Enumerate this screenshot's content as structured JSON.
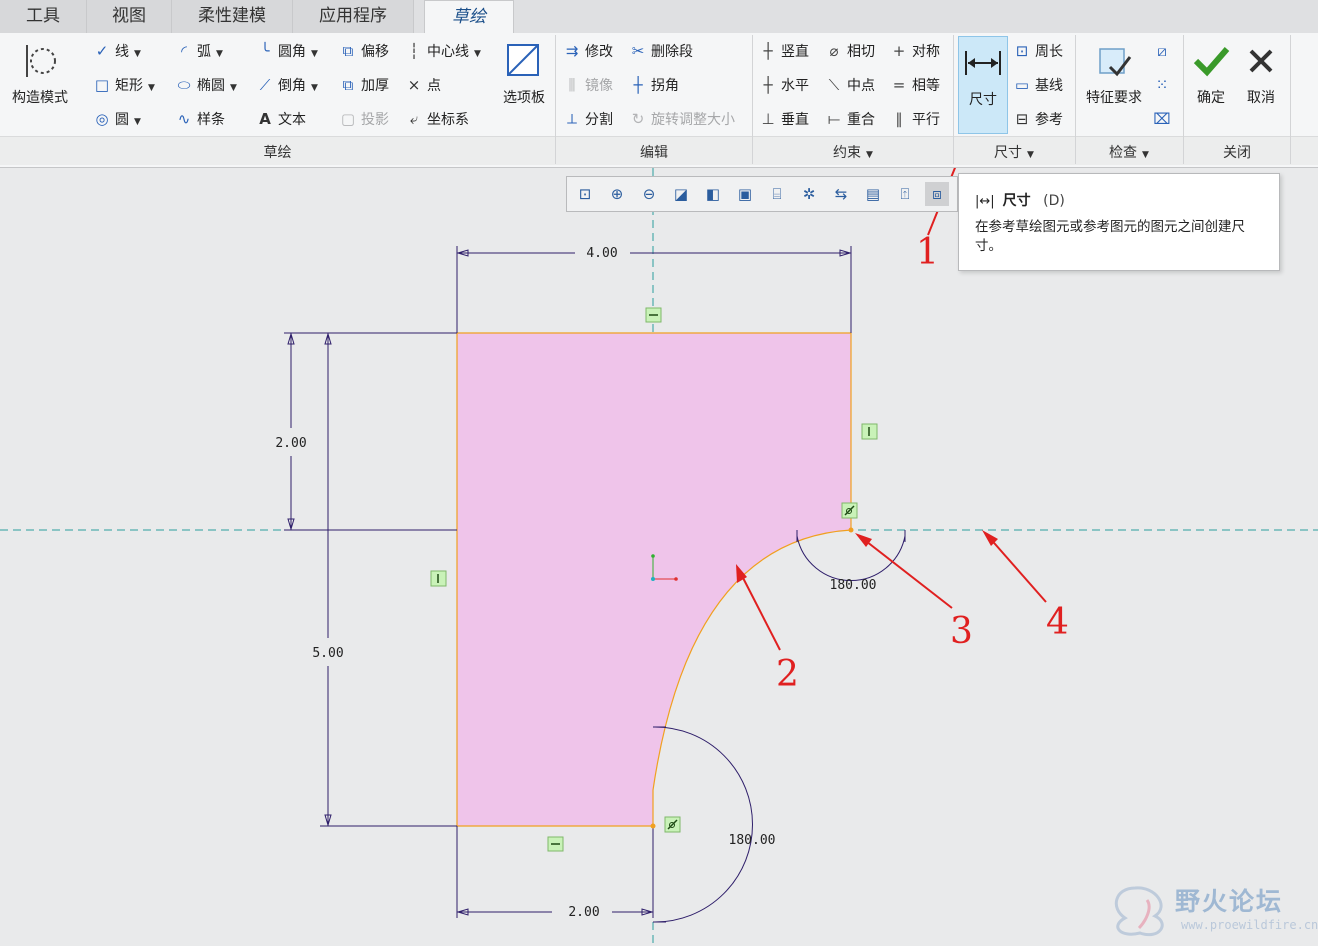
{
  "tabs": [
    {
      "label": "工具"
    },
    {
      "label": "视图"
    },
    {
      "label": "柔性建模"
    },
    {
      "label": "应用程序"
    },
    {
      "label": "草绘"
    }
  ],
  "ribbon": {
    "sketch": {
      "group_label": "草绘",
      "construction_mode": "构造模式",
      "line": "线",
      "arc": "弧",
      "fillet": "圆角",
      "offset": "偏移",
      "centerline": "中心线",
      "rectangle": "矩形",
      "ellipse": "椭圆",
      "chamfer": "倒角",
      "thicken": "加厚",
      "point": "点",
      "circle": "圆",
      "spline": "样条",
      "text": "文本",
      "project": "投影",
      "coordinate_system": "坐标系",
      "palette": "选项板"
    },
    "edit": {
      "group_label": "编辑",
      "modify": "修改",
      "delete_segment": "删除段",
      "mirror": "镜像",
      "corner": "拐角",
      "divide": "分割",
      "rotate_resize": "旋转调整大小"
    },
    "constrain": {
      "group_label": "约束",
      "vertical": "竖直",
      "tangent": "相切",
      "symmetric": "对称",
      "horizontal": "水平",
      "midpoint": "中点",
      "equal": "相等",
      "perpendicular": "垂直",
      "coincident": "重合",
      "parallel": "平行"
    },
    "dimension": {
      "group_label": "尺寸",
      "dimension": "尺寸",
      "perimeter": "周长",
      "baseline": "基线",
      "reference": "参考"
    },
    "inspect": {
      "group_label": "检查",
      "feature_requirements": "特征要求"
    },
    "close": {
      "group_label": "关闭",
      "ok": "确定",
      "cancel": "取消"
    }
  },
  "tooltip": {
    "title": "尺寸",
    "shortcut": "(D)",
    "description": "在参考草绘图元或参考图元的图元之间创建尺寸。"
  },
  "sketch": {
    "fill_color": "#efc4ea",
    "dimensions": {
      "top_width": "4.00",
      "left_height_upper": "2.00",
      "left_height_total": "5.00",
      "bottom_width": "2.00",
      "arc_angle_upper": "180.00",
      "arc_angle_lower": "180.00"
    },
    "annotations": [
      "1",
      "2",
      "3",
      "4"
    ]
  },
  "watermark": {
    "text": "野火论坛",
    "url": "www.proewildfire.cn"
  },
  "colors": {
    "accent": "#2a62b8",
    "annotation_red": "#e02020",
    "centerline": "#2a9d9d",
    "selected_orange": "#f0a020"
  }
}
